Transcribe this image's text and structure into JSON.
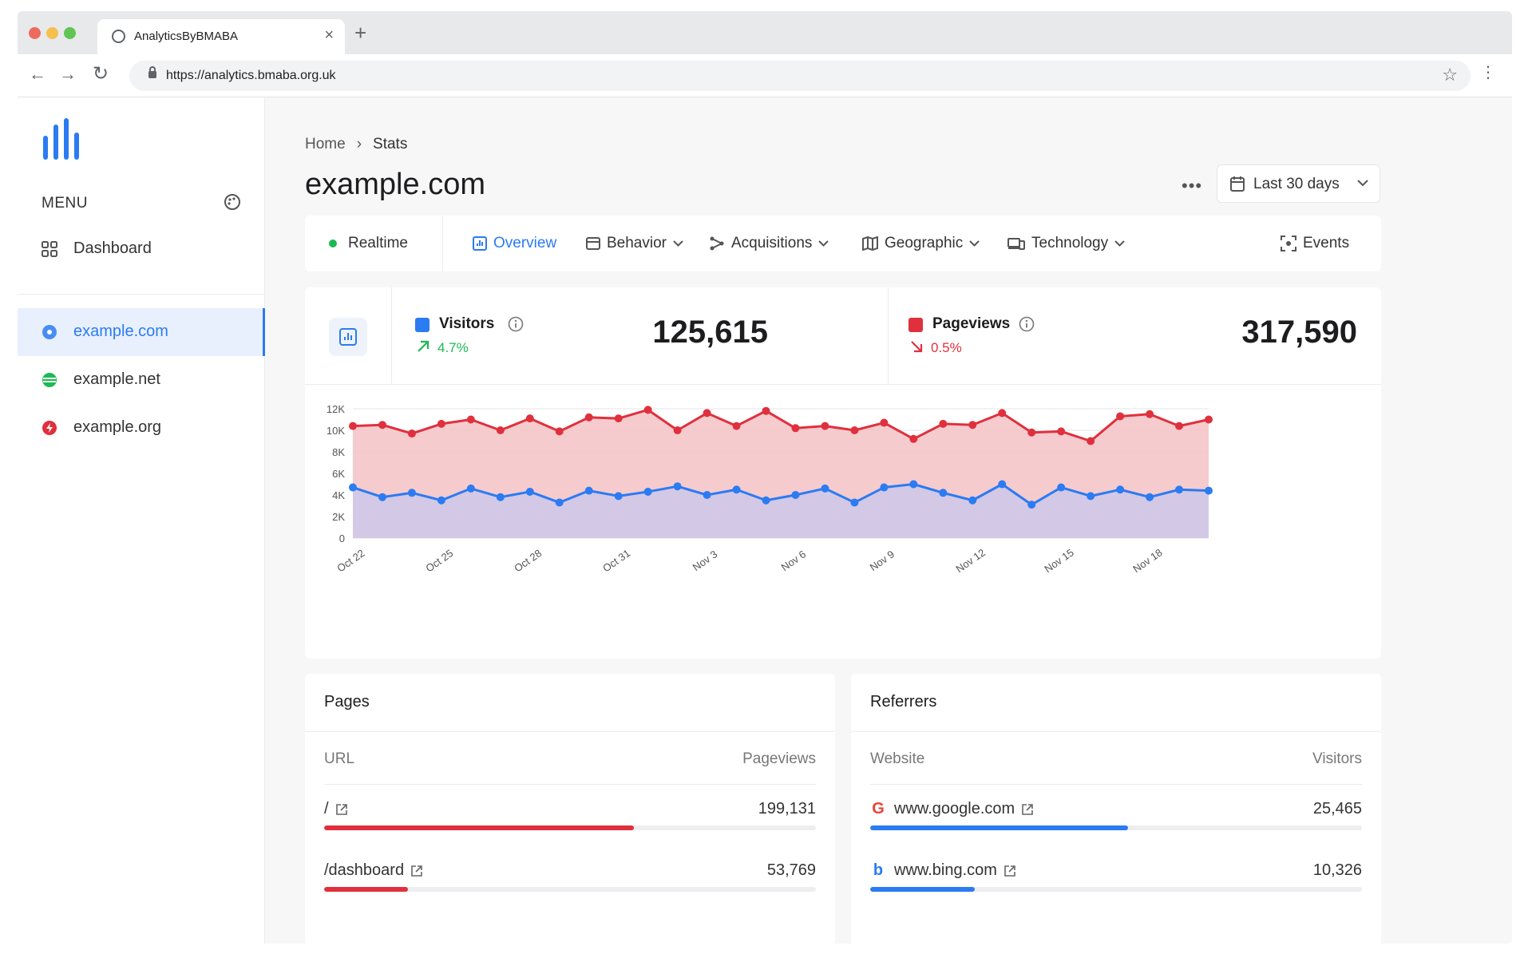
{
  "browser": {
    "tab_title": "AnalyticsByBMABA",
    "tab_close": "×",
    "new_tab": "+",
    "url": "https://analytics.bmaba.org.uk",
    "back": "←",
    "forward": "→",
    "reload": "↻",
    "star": "☆",
    "kebab": "⋮"
  },
  "sidebar": {
    "menu_title": "MENU",
    "dashboard_label": "Dashboard",
    "sites": [
      {
        "label": "example.com",
        "color": "#2b7bf2",
        "active": true
      },
      {
        "label": "example.net",
        "color": "#1db954",
        "active": false
      },
      {
        "label": "example.org",
        "color": "#e0303d",
        "active": false
      }
    ]
  },
  "header": {
    "breadcrumb_home": "Home",
    "breadcrumb_sep": "›",
    "breadcrumb_current": "Stats",
    "title": "example.com",
    "more": "•••",
    "date_range": "Last 30 days"
  },
  "nav_tabs": {
    "realtime": "Realtime",
    "overview": "Overview",
    "behavior": "Behavior",
    "acquisitions": "Acquisitions",
    "geographic": "Geographic",
    "technology": "Technology",
    "events": "Events"
  },
  "metrics": {
    "visitors": {
      "name": "Visitors",
      "change": "4.7%",
      "value": "125,615",
      "color": "#2b7bf2",
      "change_color": "#1db954"
    },
    "pageviews": {
      "name": "Pageviews",
      "change": "0.5%",
      "value": "317,590",
      "color": "#e0303d",
      "change_color": "#e0303d"
    }
  },
  "chart_data": {
    "type": "area",
    "x": [
      "Oct 22",
      "Oct 23",
      "Oct 24",
      "Oct 25",
      "Oct 26",
      "Oct 27",
      "Oct 28",
      "Oct 29",
      "Oct 30",
      "Oct 31",
      "Nov 1",
      "Nov 2",
      "Nov 3",
      "Nov 4",
      "Nov 5",
      "Nov 6",
      "Nov 7",
      "Nov 8",
      "Nov 9",
      "Nov 10",
      "Nov 11",
      "Nov 12",
      "Nov 13",
      "Nov 14",
      "Nov 15",
      "Nov 16",
      "Nov 17",
      "Nov 18",
      "Nov 19",
      "Nov 20"
    ],
    "x_tick_labels": [
      "Oct 22",
      "Oct 25",
      "Oct 28",
      "Oct 31",
      "Nov 3",
      "Nov 6",
      "Nov 9",
      "Nov 12",
      "Nov 15",
      "Nov 18"
    ],
    "y_ticks": [
      "0",
      "2K",
      "4K",
      "6K",
      "8K",
      "10K",
      "12K"
    ],
    "ylim": [
      0,
      12000
    ],
    "series": [
      {
        "name": "Pageviews",
        "color": "#e0303d",
        "fill": "#f4c5c9",
        "values": [
          10400,
          10500,
          9700,
          10600,
          11000,
          10000,
          11100,
          9900,
          11200,
          11100,
          11900,
          10000,
          11600,
          10400,
          11800,
          10200,
          10400,
          10000,
          10700,
          9200,
          10600,
          10500,
          11600,
          9800,
          9900,
          9000,
          11300,
          11500,
          10400,
          11000
        ]
      },
      {
        "name": "Visitors",
        "color": "#2b7bf2",
        "fill": "#cfc8e9",
        "values": [
          4700,
          3800,
          4200,
          3500,
          4600,
          3800,
          4300,
          3300,
          4400,
          3900,
          4300,
          4800,
          4000,
          4500,
          3500,
          4000,
          4600,
          3300,
          4700,
          5000,
          4200,
          3500,
          5000,
          3100,
          4700,
          3900,
          4500,
          3800,
          4500,
          4400
        ]
      }
    ],
    "grid": true
  },
  "pages": {
    "title": "Pages",
    "col_left": "URL",
    "col_right": "Pageviews",
    "rows": [
      {
        "label": "/",
        "value": "199,131",
        "fraction": 0.63
      },
      {
        "label": "/dashboard",
        "value": "53,769",
        "fraction": 0.17
      }
    ],
    "bar_color": "#e0303d"
  },
  "referrers": {
    "title": "Referrers",
    "col_left": "Website",
    "col_right": "Visitors",
    "rows": [
      {
        "label": "www.google.com",
        "value": "25,465",
        "fraction": 0.525,
        "icon": "G",
        "icon_color": "#ea4335"
      },
      {
        "label": "www.bing.com",
        "value": "10,326",
        "fraction": 0.212,
        "icon": "b",
        "icon_color": "#2b7bf2"
      }
    ],
    "bar_color": "#2b7bf2"
  }
}
